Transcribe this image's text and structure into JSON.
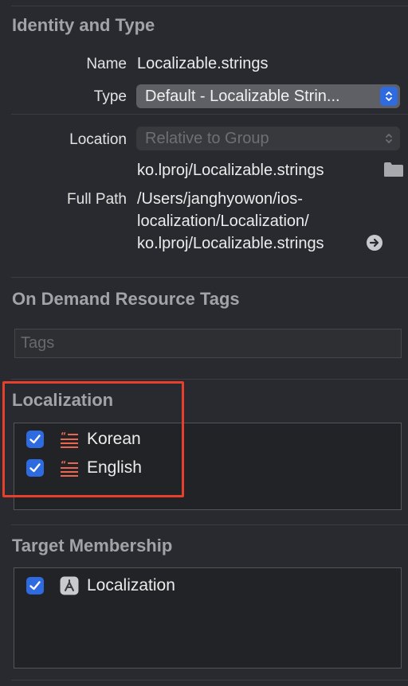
{
  "identity": {
    "section_title": "Identity and Type",
    "name_label": "Name",
    "name_value": "Localizable.strings",
    "type_label": "Type",
    "type_value": "Default - Localizable Strin...",
    "location_label": "Location",
    "location_value": "Relative to Group",
    "location_file": "ko.lproj/Localizable.strings",
    "full_path_label": "Full Path",
    "full_path_lines": [
      "/Users/janghyowon/ios-",
      "localization/Localization/",
      "ko.lproj/Localizable.strings"
    ]
  },
  "on_demand": {
    "section_title": "On Demand Resource Tags",
    "tags_placeholder": "Tags"
  },
  "localization": {
    "section_title": "Localization",
    "items": [
      {
        "label": "Korean",
        "checked": true
      },
      {
        "label": "English",
        "checked": true
      }
    ]
  },
  "target_membership": {
    "section_title": "Target Membership",
    "items": [
      {
        "label": "Localization",
        "checked": true
      }
    ]
  },
  "colors": {
    "accent": "#2f6be0",
    "highlight": "#e5402b",
    "strings_icon": "#e8674e"
  }
}
